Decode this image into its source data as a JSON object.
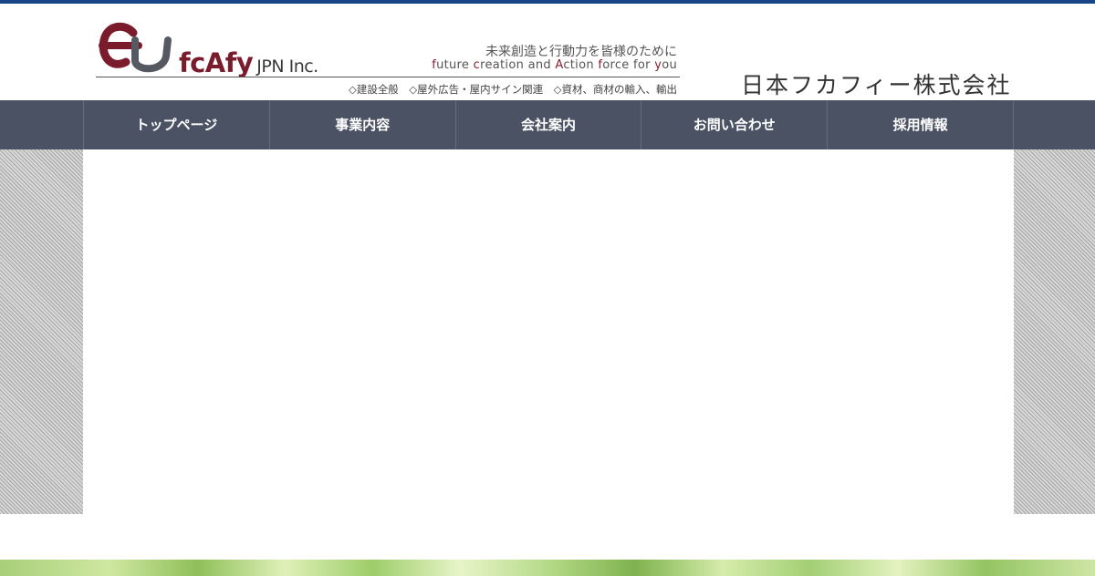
{
  "header": {
    "logo_brand": "fcAfy",
    "logo_suffix": "JPN Inc.",
    "tagline_jp": "未来創造と行動力を皆様のために",
    "tagline_en_parts": [
      "f",
      "uture ",
      "c",
      "reation and ",
      "A",
      "ction ",
      "f",
      "orce for ",
      "y",
      "ou"
    ],
    "services": "◇建設全般　◇屋外広告・屋内サイン関連　◇資材、商材の輸入、輸出",
    "company_name": "日本フカフィー株式会社",
    "colors": {
      "brand": "#7a1c2b",
      "topbar": "#1a4584"
    }
  },
  "nav": {
    "items": [
      {
        "label": "トップページ"
      },
      {
        "label": "事業内容"
      },
      {
        "label": "会社案内"
      },
      {
        "label": "お問い合わせ"
      },
      {
        "label": "採用情報"
      }
    ],
    "background": "#4a5263"
  }
}
